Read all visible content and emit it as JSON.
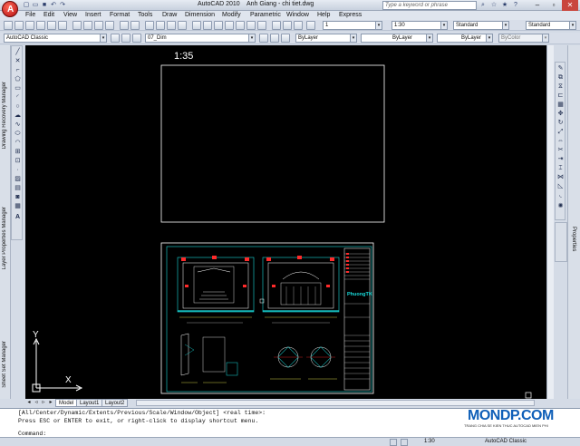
{
  "window": {
    "app_title": "AutoCAD 2010",
    "doc_title": "Anh Giang - chi tiet.dwg",
    "search_placeholder": "Type a keyword or phrase"
  },
  "menu": [
    "File",
    "Edit",
    "View",
    "Insert",
    "Format",
    "Tools",
    "Draw",
    "Dimension",
    "Modify",
    "Parametric",
    "Window",
    "Help",
    "Express"
  ],
  "toolbar1": {
    "layer_number": "1",
    "scale": "1:30",
    "text_style": "Standard",
    "dim_style": "Standard"
  },
  "toolbar2": {
    "workspace": "AutoCAD Classic",
    "layer": "07_Dim",
    "color": "ByLayer",
    "linetype": "ByLayer",
    "lineweight": "ByLayer",
    "plotstyle": "ByColor"
  },
  "panels": {
    "left": [
      "Drawing Recovery Manager",
      "Layer Properties Manager",
      "Sheet Set Manager"
    ],
    "right": "Properties"
  },
  "drawing": {
    "scale_label": "1:35",
    "logo_text": "PhuongTK"
  },
  "tabs": [
    "Model",
    "Layout1",
    "Layout2"
  ],
  "command": {
    "line1": "[All/Center/Dynamic/Extents/Previous/Scale/Window/Object] <real time>:",
    "line2": "Press ESC or ENTER to exit, or right-click to display shortcut menu.",
    "prompt": "Command:"
  },
  "status": {
    "workspace": "AutoCAD Classic"
  },
  "watermark": {
    "brand": "MONDP.COM",
    "tagline": "TRANG CHIA SE KIEN THUC AUTOCAD MIEN PHI"
  },
  "ucs": {
    "x": "X",
    "y": "Y"
  }
}
